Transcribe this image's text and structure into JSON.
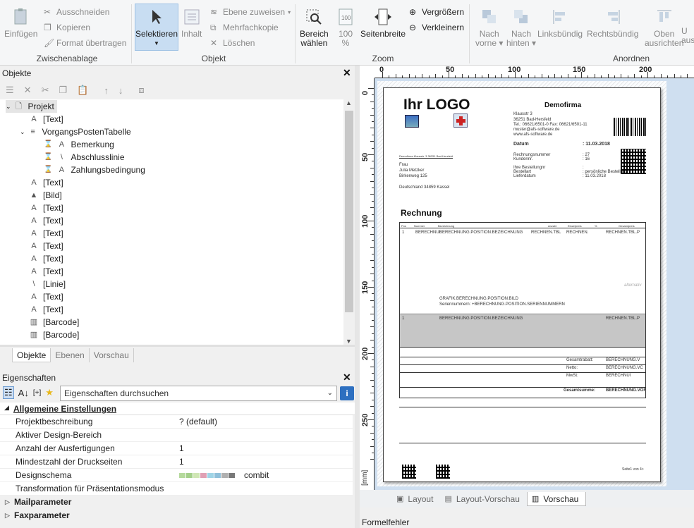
{
  "ribbon": {
    "einfuegen": "Einfügen",
    "ausschneiden": "Ausschneiden",
    "kopieren": "Kopieren",
    "format": "Format übertragen",
    "zwischenablage": "Zwischenablage",
    "selektieren": "Selektieren",
    "inhalt": "Inhalt",
    "ebene": "Ebene zuweisen",
    "mehrfach": "Mehrfachkopie",
    "loeschen": "Löschen",
    "objekt": "Objekt",
    "bereich1": "Bereich",
    "bereich2": "wählen",
    "zoom100a": "100",
    "zoom100b": "%",
    "seitenbreite": "Seitenbreite",
    "vergroessern": "Vergrößern",
    "verkleinern": "Verkleinern",
    "zoom": "Zoom",
    "nachvorne1": "Nach",
    "nachvorne2": "vorne",
    "nachhinten1": "Nach",
    "nachhinten2": "hinten",
    "linksbuendig": "Linksbündig",
    "rechtsbuendig": "Rechtsbündig",
    "oben1": "Oben",
    "oben2": "ausrichten",
    "unten1": "U",
    "unten2": "aus",
    "anordnen": "Anordnen"
  },
  "objects": {
    "title": "Objekte",
    "tree": [
      {
        "label": "Projekt",
        "icon": "page-icon",
        "level": 0
      },
      {
        "label": "[Text]",
        "icon": "A",
        "level": 1
      },
      {
        "label": "VorgangsPostenTabelle",
        "icon": "≡",
        "level": 1
      },
      {
        "label": "Bemerkung",
        "icon": "A",
        "level": 2
      },
      {
        "label": "Abschlusslinie",
        "icon": "\\",
        "level": 2
      },
      {
        "label": "Zahlungsbedingung",
        "icon": "A",
        "level": 2
      },
      {
        "label": "[Text]",
        "icon": "A",
        "level": 1
      },
      {
        "label": "[Bild]",
        "icon": "img",
        "level": 1
      },
      {
        "label": "[Text]",
        "icon": "A",
        "level": 1
      },
      {
        "label": "[Text]",
        "icon": "A",
        "level": 1
      },
      {
        "label": "[Text]",
        "icon": "A",
        "level": 1
      },
      {
        "label": "[Text]",
        "icon": "A",
        "level": 1
      },
      {
        "label": "[Text]",
        "icon": "A",
        "level": 1
      },
      {
        "label": "[Text]",
        "icon": "A",
        "level": 1
      },
      {
        "label": "[Linie]",
        "icon": "\\",
        "level": 1
      },
      {
        "label": "[Text]",
        "icon": "A",
        "level": 1
      },
      {
        "label": "[Text]",
        "icon": "A",
        "level": 1
      },
      {
        "label": "[Barcode]",
        "icon": "barcode",
        "level": 1
      },
      {
        "label": "[Barcode]",
        "icon": "barcode",
        "level": 1
      }
    ],
    "tabs": [
      "Objekte",
      "Ebenen",
      "Vorschau"
    ]
  },
  "properties": {
    "title": "Eigenschaften",
    "search_placeholder": "Eigenschaften durchsuchen",
    "section": "Allgemeine Einstellungen",
    "rows": [
      {
        "k": "Projektbeschreibung",
        "v": "? (default)"
      },
      {
        "k": "Aktiver Design-Bereich",
        "v": ""
      },
      {
        "k": "Anzahl der Ausfertigungen",
        "v": "1"
      },
      {
        "k": "Mindestzahl der Druckseiten",
        "v": "1"
      },
      {
        "k": "Designschema",
        "v": "combit"
      },
      {
        "k": "Transformation für Präsentationsmodus",
        "v": ""
      }
    ],
    "mail": "Mailparameter",
    "fax": "Faxparameter"
  },
  "ruler": {
    "top": [
      "0",
      "50",
      "100",
      "150",
      "200"
    ],
    "left": [
      "0",
      "50",
      "100",
      "150",
      "200",
      "250"
    ],
    "unit": "[mm]"
  },
  "invoice": {
    "logo": "Ihr LOGO",
    "company": "Demofirma",
    "addr": [
      "Klausstr 3",
      "36251 Bad-Hersfeld",
      "Tel.: 06621/6501-0 Fax: 06621/6501-11",
      "muster@afs-software.de",
      "www.afs-software.de"
    ],
    "datum_label": "Datum",
    "datum": ": 11.03.2018",
    "meta": [
      [
        "Rechnungsnummer",
        ": 27"
      ],
      [
        "Kundennr.",
        ": 16"
      ],
      [
        "",
        ""
      ],
      [
        "Ihre Bestellungnr",
        ":"
      ],
      [
        "Bestellart",
        ": persönliche Bestellung"
      ],
      [
        "Lieferdatum",
        ": 11.03.2018"
      ]
    ],
    "sender": "Demofirma Klausstr. 3 36251 Bad-Hersfeld",
    "recipient": [
      "Frau",
      "Julia Metzker",
      "Birkenweg 125",
      "",
      "Deutschland 34859 Kassel"
    ],
    "heading": "Rechnung",
    "cols": [
      "Pos",
      "Nummer",
      "Bezeichnung",
      "Anzahl",
      "Einzelpreis",
      "%",
      "Gesamtpreis"
    ],
    "row1": [
      "1",
      "BERECHNUI",
      "BERECHNUNG.POSITION.BEZEICHNUNG",
      "RECHNEN.TBL",
      "RECHNEN.",
      "RECHNEN.TBL.P"
    ],
    "grafik": "GRAFIK.BERECHNUNG.POSITION.BILD",
    "serien": "Seriennummern: +BERECHNUNG.POSITION.SERIENNUMMERN",
    "gray_text": "alternativ",
    "summary": [
      "Gesamtrabatt:",
      "BERECHNUNG.V",
      "Netto:",
      "BERECHNUNG.VC",
      "MwSt:",
      "BERECHNUI"
    ],
    "gesamt": "Gesamtsumme:",
    "gesamt_val": "BERECHNUNG.VOF",
    "seite": "Seite1 von 4>"
  },
  "preview_tabs": [
    "Layout",
    "Layout-Vorschau",
    "Vorschau"
  ],
  "status": "Formelfehler"
}
